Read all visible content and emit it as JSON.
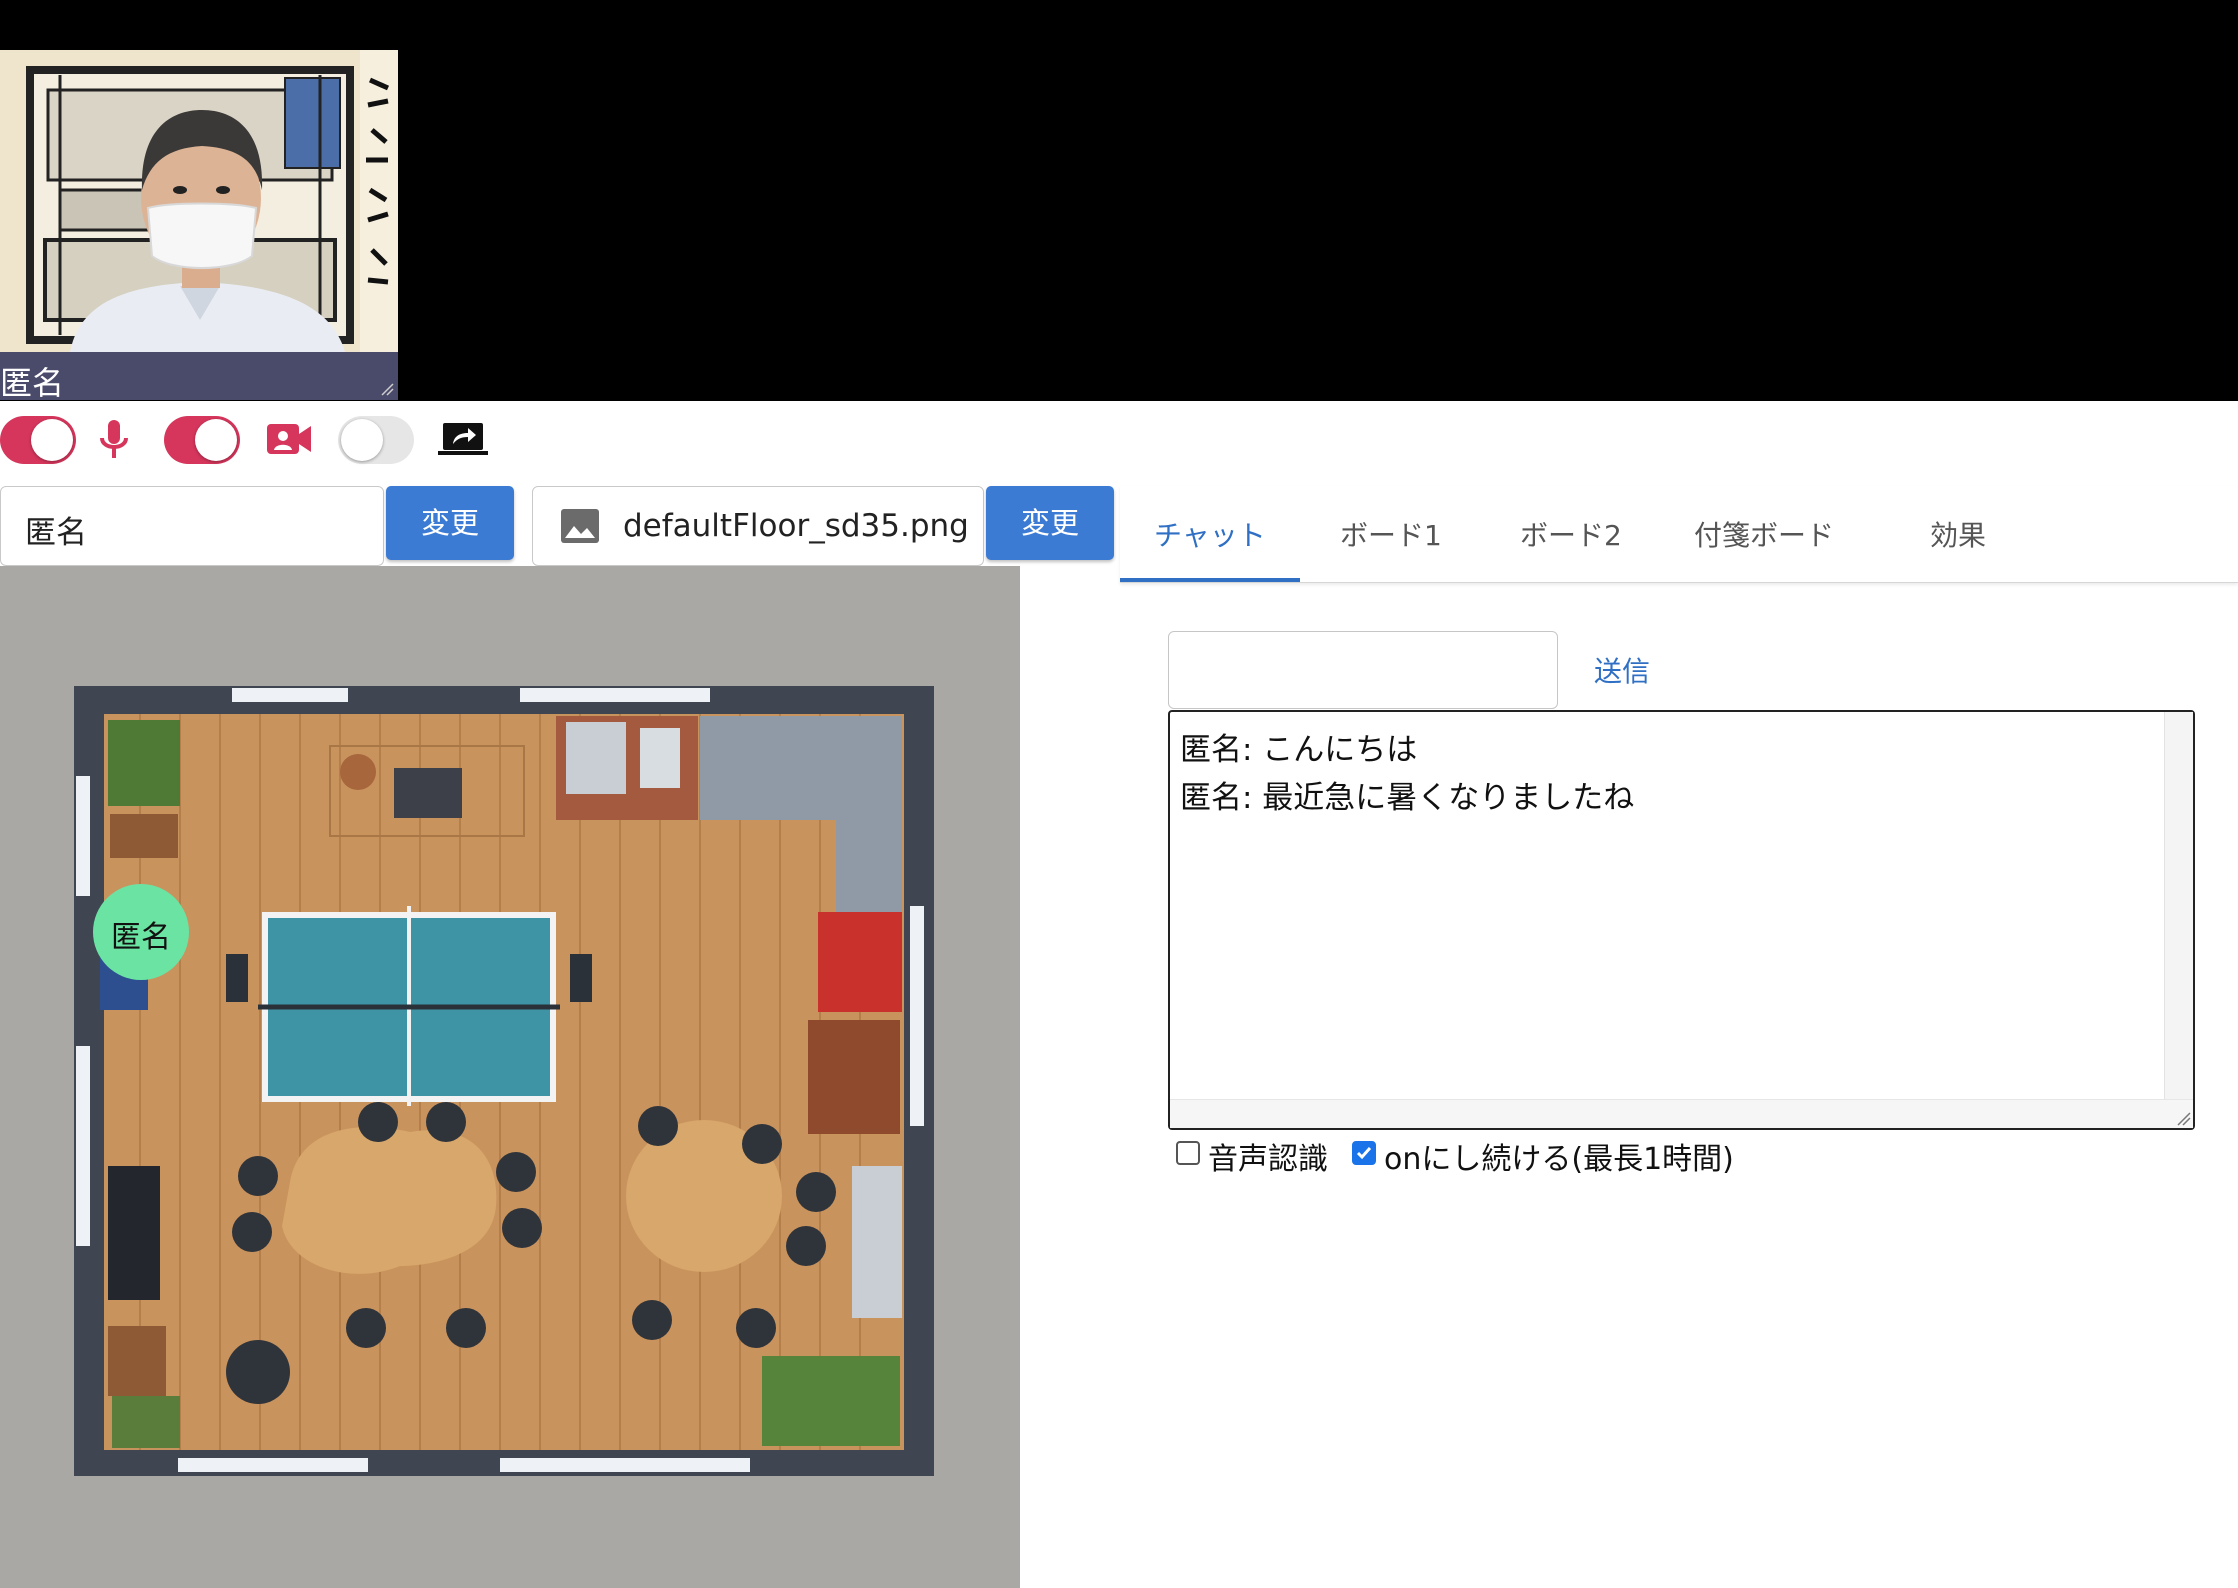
{
  "video": {
    "participant_name": "匿名"
  },
  "controls": {
    "mic_toggle": {
      "on": true,
      "icon": "mic-icon"
    },
    "camera_toggle": {
      "on": true,
      "icon": "video-camera-icon"
    },
    "screen_share_toggle": {
      "on": false,
      "icon": "screen-share-icon"
    },
    "accent_color": "#d6365c"
  },
  "name_form": {
    "value": "匿名",
    "button_label": "変更"
  },
  "floor_form": {
    "file_name": "defaultFloor_sd35.png",
    "icon": "image-icon",
    "button_label": "変更"
  },
  "tabs": [
    {
      "label": "チャット",
      "active": true
    },
    {
      "label": "ボード1",
      "active": false
    },
    {
      "label": "ボード2",
      "active": false
    },
    {
      "label": "付箋ボード",
      "active": false
    },
    {
      "label": "効果",
      "active": false
    }
  ],
  "chat": {
    "input_value": "",
    "send_label": "送信",
    "messages": [
      "匿名: こんにちは",
      "匿名: 最近急に暑くなりましたね"
    ]
  },
  "options": {
    "speech_recognition": {
      "label": "音声認識",
      "checked": false
    },
    "keep_on": {
      "label": "onにし続ける(最長1時間)",
      "checked": true
    }
  },
  "floor": {
    "avatar_name": "匿名",
    "avatar_color": "#6be3a3"
  }
}
